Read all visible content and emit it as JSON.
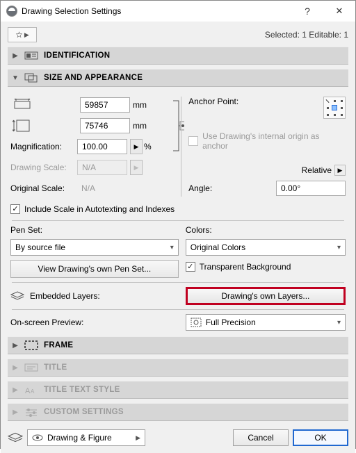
{
  "window": {
    "title": "Drawing Selection Settings"
  },
  "status": "Selected: 1 Editable: 1",
  "sections": {
    "identification": "IDENTIFICATION",
    "size": "SIZE AND APPEARANCE",
    "frame": "FRAME",
    "title": "TITLE",
    "title_text_style": "TITLE TEXT STYLE",
    "custom": "CUSTOM SETTINGS"
  },
  "size": {
    "width_value": "59857",
    "height_value": "75746",
    "width_unit": "mm",
    "height_unit": "mm",
    "magnification_label": "Magnification:",
    "magnification_value": "100.00",
    "percent": "%",
    "drawing_scale_label": "Drawing Scale:",
    "drawing_scale_value": "N/A",
    "original_scale_label": "Original Scale:",
    "original_scale_value": "N/A",
    "include_scale_label": "Include Scale in Autotexting and Indexes",
    "anchor_label": "Anchor Point:",
    "use_internal_label": "Use Drawing's internal origin as anchor",
    "relative_label": "Relative",
    "angle_label": "Angle:",
    "angle_value": "0.00°"
  },
  "penset": {
    "label": "Pen Set:",
    "value": "By source file",
    "view_btn": "View Drawing's own Pen Set..."
  },
  "colors": {
    "label": "Colors:",
    "value": "Original Colors",
    "transparent_label": "Transparent Background"
  },
  "layers": {
    "label": "Embedded Layers:",
    "btn": "Drawing's own Layers..."
  },
  "preview": {
    "label": "On-screen Preview:",
    "value": "Full Precision"
  },
  "footer": {
    "combo": "Drawing & Figure",
    "cancel": "Cancel",
    "ok": "OK"
  }
}
